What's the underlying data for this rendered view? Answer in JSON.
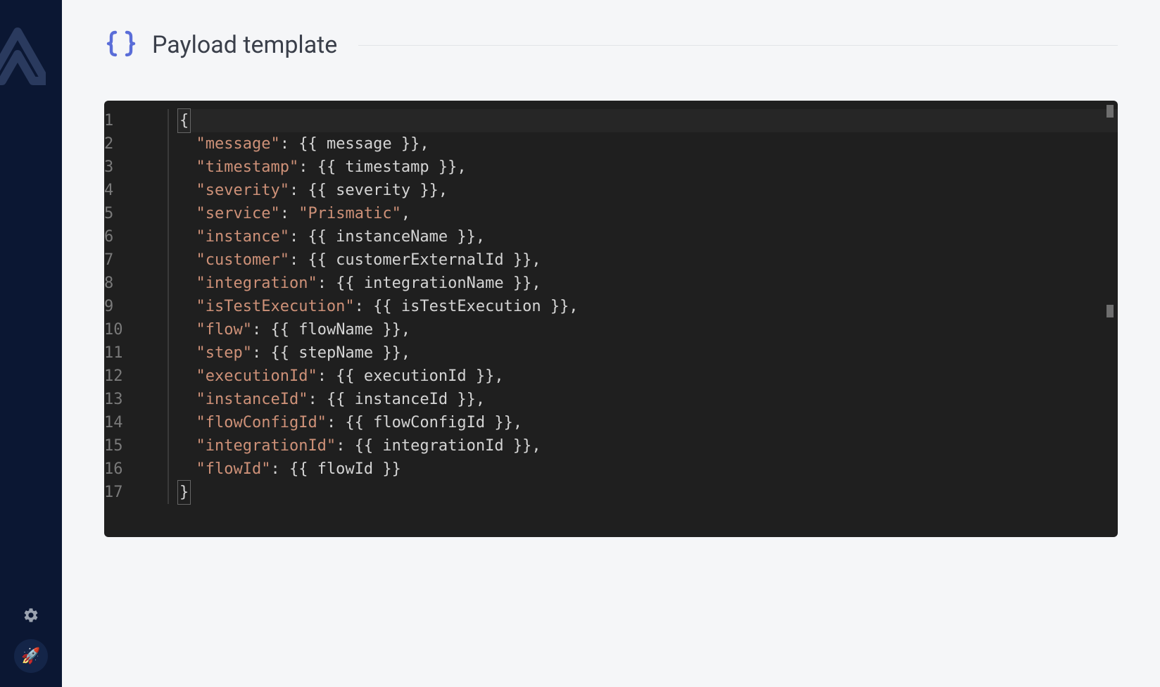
{
  "section": {
    "title": "Payload template",
    "icon": "braces-icon"
  },
  "editor": {
    "lineCount": 17,
    "lines": [
      {
        "n": 1,
        "segments": [
          {
            "t": "{",
            "c": "braceBox"
          }
        ]
      },
      {
        "n": 2,
        "segments": [
          {
            "t": "  ",
            "c": "p"
          },
          {
            "t": "\"message\"",
            "c": "key"
          },
          {
            "t": ": {{ message }},",
            "c": "p"
          }
        ]
      },
      {
        "n": 3,
        "segments": [
          {
            "t": "  ",
            "c": "p"
          },
          {
            "t": "\"timestamp\"",
            "c": "key"
          },
          {
            "t": ": {{ timestamp }},",
            "c": "p"
          }
        ]
      },
      {
        "n": 4,
        "segments": [
          {
            "t": "  ",
            "c": "p"
          },
          {
            "t": "\"severity\"",
            "c": "key"
          },
          {
            "t": ": {{ severity }},",
            "c": "p"
          }
        ]
      },
      {
        "n": 5,
        "segments": [
          {
            "t": "  ",
            "c": "p"
          },
          {
            "t": "\"service\"",
            "c": "key"
          },
          {
            "t": ": ",
            "c": "p"
          },
          {
            "t": "\"Prismatic\"",
            "c": "str"
          },
          {
            "t": ",",
            "c": "p"
          }
        ]
      },
      {
        "n": 6,
        "segments": [
          {
            "t": "  ",
            "c": "p"
          },
          {
            "t": "\"instance\"",
            "c": "key"
          },
          {
            "t": ": {{ instanceName }},",
            "c": "p"
          }
        ]
      },
      {
        "n": 7,
        "segments": [
          {
            "t": "  ",
            "c": "p"
          },
          {
            "t": "\"customer\"",
            "c": "key"
          },
          {
            "t": ": {{ customerExternalId }},",
            "c": "p"
          }
        ]
      },
      {
        "n": 8,
        "segments": [
          {
            "t": "  ",
            "c": "p"
          },
          {
            "t": "\"integration\"",
            "c": "key"
          },
          {
            "t": ": {{ integrationName }},",
            "c": "p"
          }
        ]
      },
      {
        "n": 9,
        "segments": [
          {
            "t": "  ",
            "c": "p"
          },
          {
            "t": "\"isTestExecution\"",
            "c": "key"
          },
          {
            "t": ": {{ isTestExecution }},",
            "c": "p"
          }
        ]
      },
      {
        "n": 10,
        "segments": [
          {
            "t": "  ",
            "c": "p"
          },
          {
            "t": "\"flow\"",
            "c": "key"
          },
          {
            "t": ": {{ flowName }},",
            "c": "p"
          }
        ]
      },
      {
        "n": 11,
        "segments": [
          {
            "t": "  ",
            "c": "p"
          },
          {
            "t": "\"step\"",
            "c": "key"
          },
          {
            "t": ": {{ stepName }},",
            "c": "p"
          }
        ]
      },
      {
        "n": 12,
        "segments": [
          {
            "t": "  ",
            "c": "p"
          },
          {
            "t": "\"executionId\"",
            "c": "key"
          },
          {
            "t": ": {{ executionId }},",
            "c": "p"
          }
        ]
      },
      {
        "n": 13,
        "segments": [
          {
            "t": "  ",
            "c": "p"
          },
          {
            "t": "\"instanceId\"",
            "c": "key"
          },
          {
            "t": ": {{ instanceId }},",
            "c": "p"
          }
        ]
      },
      {
        "n": 14,
        "segments": [
          {
            "t": "  ",
            "c": "p"
          },
          {
            "t": "\"flowConfigId\"",
            "c": "key"
          },
          {
            "t": ": {{ flowConfigId }},",
            "c": "p"
          }
        ]
      },
      {
        "n": 15,
        "segments": [
          {
            "t": "  ",
            "c": "p"
          },
          {
            "t": "\"integrationId\"",
            "c": "key"
          },
          {
            "t": ": {{ integrationId }},",
            "c": "p"
          }
        ]
      },
      {
        "n": 16,
        "segments": [
          {
            "t": "  ",
            "c": "p"
          },
          {
            "t": "\"flowId\"",
            "c": "key"
          },
          {
            "t": ": {{ flowId }}",
            "c": "p"
          }
        ]
      },
      {
        "n": 17,
        "segments": [
          {
            "t": "}",
            "c": "braceBox"
          }
        ]
      }
    ]
  },
  "sidebar": {
    "settingsIcon": "gear-icon",
    "rocketIcon": "rocket-icon"
  }
}
